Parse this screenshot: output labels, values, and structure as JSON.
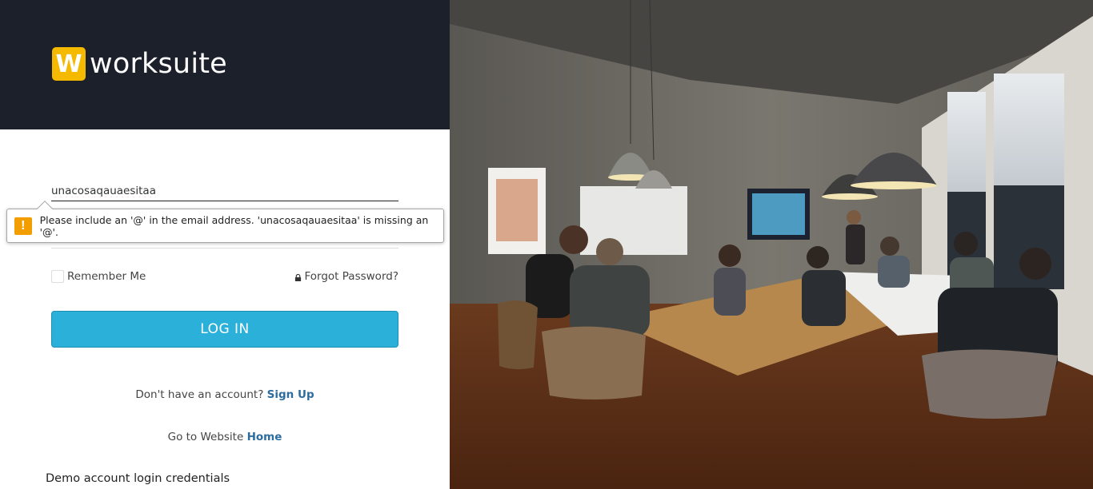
{
  "brand": {
    "logo_letter": "W",
    "name": "worksuite",
    "accent_color": "#f5b900",
    "header_bg": "#1b202b"
  },
  "login_form": {
    "email_value": "unacosaqauaesitaa",
    "validation_message": "Please include an '@' in the email address. 'unacosaqauaesitaa' is missing an '@'.",
    "warning_icon_glyph": "!",
    "remember_label": "Remember Me",
    "forgot_label": "Forgot Password?",
    "login_label": "LOG IN",
    "button_color": "#2bb0da"
  },
  "footer_links": {
    "signup_prompt": "Don't have an account?",
    "signup_label": "Sign Up",
    "website_prompt": "Go to Website",
    "home_label": "Home",
    "demo_title": "Demo account login credentials"
  },
  "photo": {
    "icon": "office-meeting-photo"
  }
}
